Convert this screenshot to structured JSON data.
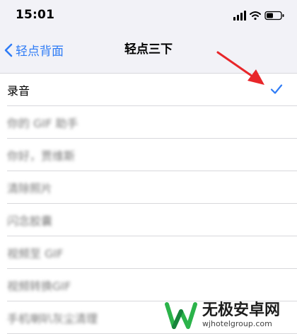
{
  "status_bar": {
    "time": "15:01"
  },
  "nav": {
    "back_label": "轻点背面",
    "title": "轻点三下"
  },
  "list": {
    "items": [
      {
        "label": "录音",
        "selected": true
      },
      {
        "label": "你的 GIF 助手",
        "selected": false
      },
      {
        "label": "你好，贾维斯",
        "selected": false
      },
      {
        "label": "清除照片",
        "selected": false
      },
      {
        "label": "闪念胶囊",
        "selected": false
      },
      {
        "label": "视频至 GIF",
        "selected": false
      },
      {
        "label": "视频转换GIF",
        "selected": false
      },
      {
        "label": "手机喇叭灰尘清理",
        "selected": false
      }
    ]
  },
  "colors": {
    "accent": "#2f7cf6",
    "annotation": "#e8262a",
    "watermark_green": "#2bb34a"
  },
  "watermark": {
    "title": "无极安卓网",
    "url": "wjhotelgroup.com"
  }
}
